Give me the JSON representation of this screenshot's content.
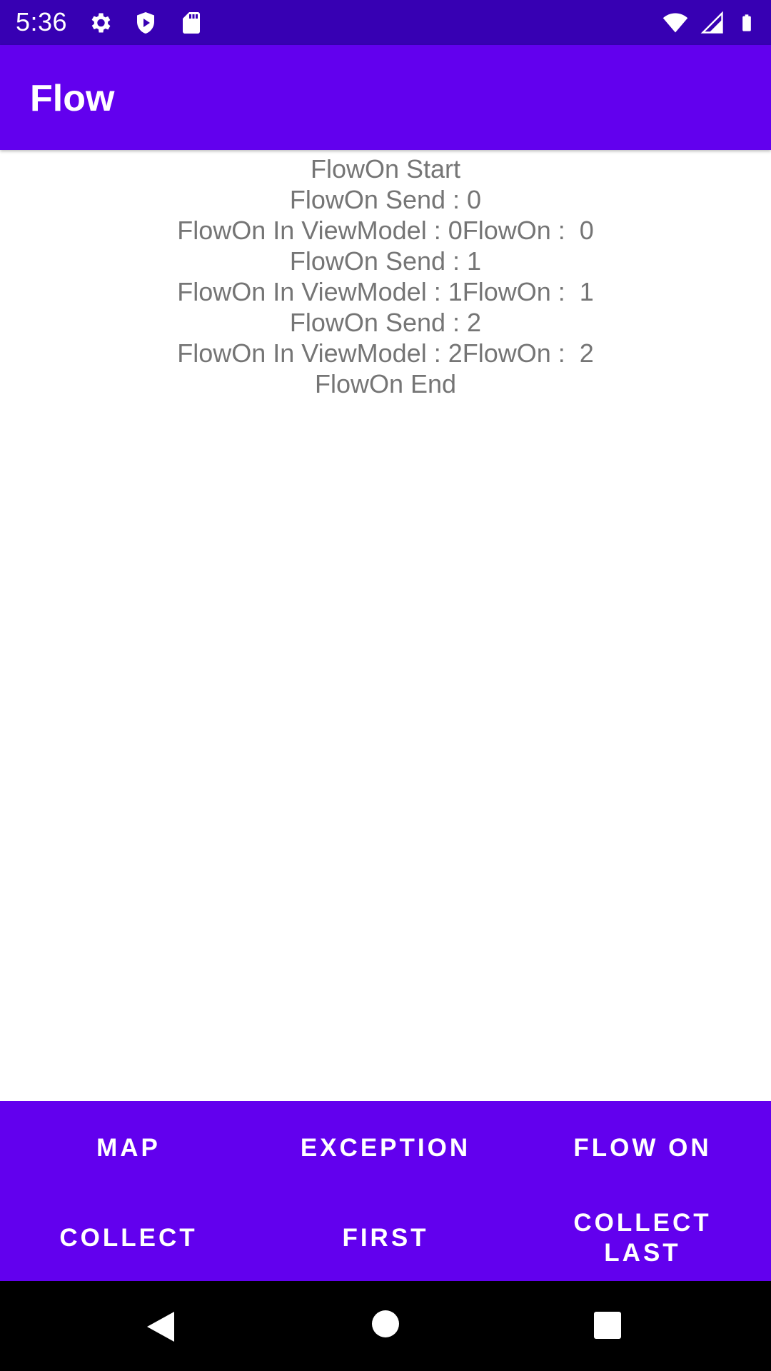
{
  "status_bar": {
    "time": "5:36",
    "icons": [
      "settings-icon",
      "shield-icon",
      "sd-card-icon",
      "wifi-icon",
      "signal-icon",
      "battery-icon"
    ]
  },
  "app_bar": {
    "title": "Flow"
  },
  "log": {
    "lines": [
      "FlowOn Start",
      "FlowOn Send : 0",
      "FlowOn In ViewModel : 0FlowOn :  0",
      "FlowOn Send : 1",
      "FlowOn In ViewModel : 1FlowOn :  1",
      "FlowOn Send : 2",
      "FlowOn In ViewModel : 2FlowOn :  2",
      "FlowOn End"
    ]
  },
  "buttons": {
    "map": "MAP",
    "exception": "EXCEPTION",
    "flow_on": "FLOW ON",
    "collect": "COLLECT",
    "first": "FIRST",
    "collect_last": "COLLECT\nLAST"
  },
  "nav_bar": {
    "icons": [
      "back-icon",
      "home-icon",
      "recents-icon"
    ]
  },
  "colors": {
    "status_bar": "#3700b3",
    "primary": "#6200ee",
    "log_text": "#757575",
    "nav_bar": "#000000"
  }
}
